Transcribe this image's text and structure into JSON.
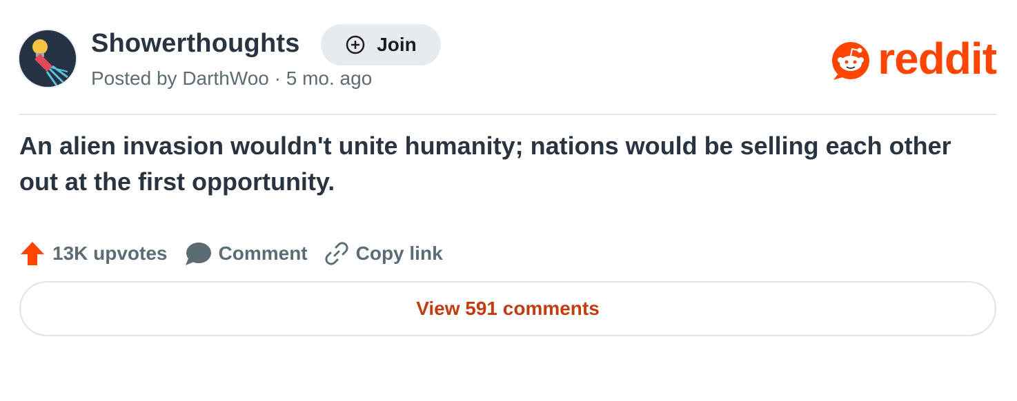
{
  "post": {
    "subreddit": "Showerthoughts",
    "join_label": "Join",
    "posted_by_prefix": "Posted by",
    "author": "DarthWoo",
    "separator": "·",
    "age": "5 mo. ago",
    "title": "An alien invasion wouldn't unite humanity; nations would be selling each other out at the first opportunity."
  },
  "brand": {
    "wordmark": "reddit",
    "color": "#ff4500"
  },
  "actions": {
    "upvotes": "13K upvotes",
    "comment": "Comment",
    "copy_link": "Copy link"
  },
  "footer": {
    "view_comments": "View 591 comments"
  },
  "colors": {
    "title_text": "#2a3440",
    "meta_text": "#5c6c74",
    "upvote_icon": "#ff4500",
    "view_comments_text": "#c23c0f"
  },
  "icons": {
    "avatar": "lightbulb-shower-icon",
    "join": "plus-circle-icon",
    "upvote": "upvote-arrow-icon",
    "comment": "comment-bubble-icon",
    "copy_link": "link-icon",
    "logo": "snoo-icon"
  }
}
